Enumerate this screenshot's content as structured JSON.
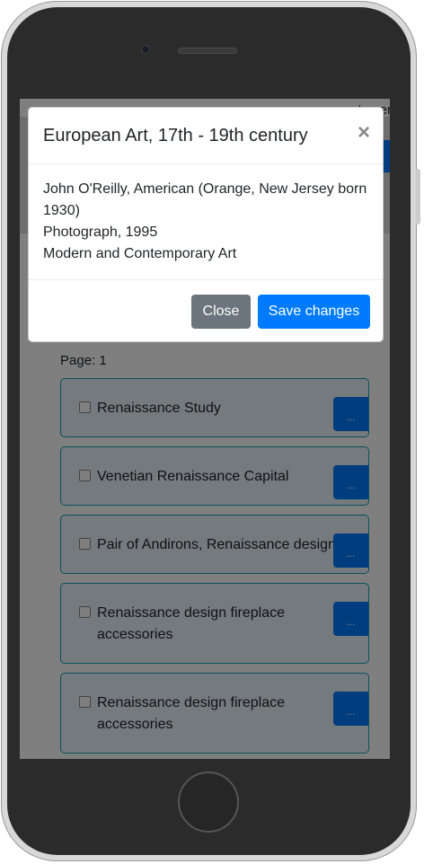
{
  "header": {
    "current_user": "current user"
  },
  "list": {
    "page_label": "Page: 1",
    "more_label": "...",
    "items": [
      {
        "title": "Renaissance Study"
      },
      {
        "title": "Venetian Renaissance Capital"
      },
      {
        "title": "Pair of Andirons, Renaissance design"
      },
      {
        "title": "Renaissance design fireplace accessories"
      },
      {
        "title": "Renaissance design fireplace accessories"
      }
    ]
  },
  "modal": {
    "title": "European Art, 17th - 19th century",
    "close_icon": "×",
    "lines": [
      "John O'Reilly, American (Orange, New Jersey born 1930)",
      "Photograph, 1995",
      "Modern and Contemporary Art"
    ],
    "close_label": "Close",
    "save_label": "Save changes"
  }
}
